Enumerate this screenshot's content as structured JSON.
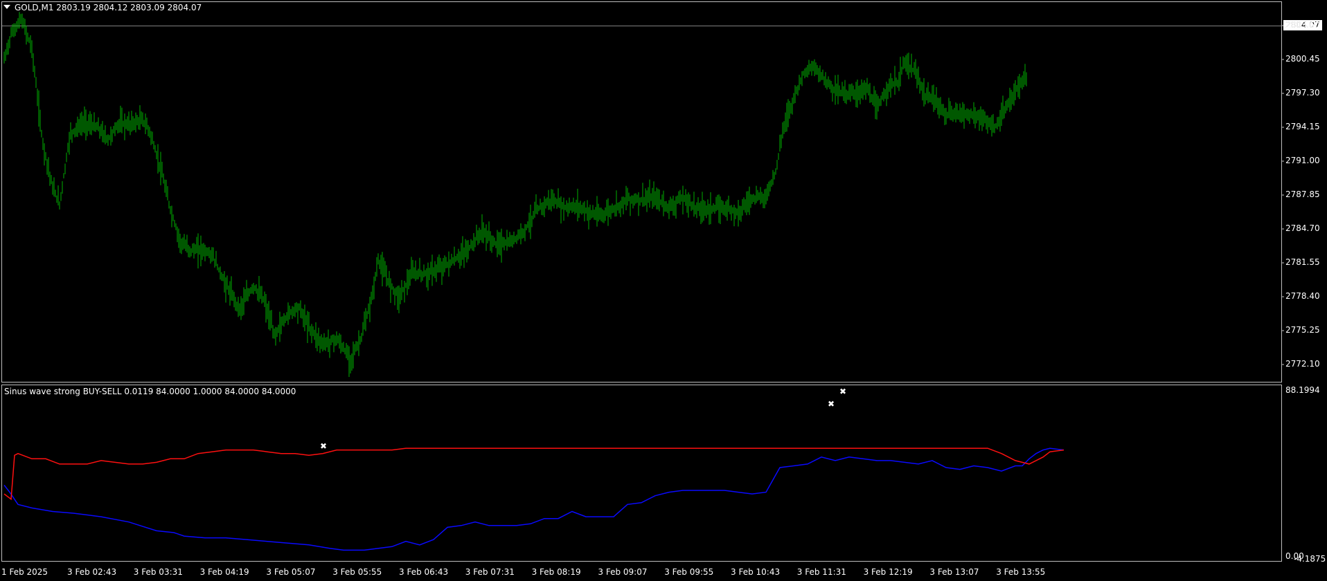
{
  "main_chart": {
    "title": "GOLD,M1  2803.19 2804.12 2803.09 2804.07",
    "current_price": "2804.07",
    "price_axis": [
      "2803.60",
      "2800.45",
      "2797.30",
      "2794.15",
      "2791.00",
      "2787.85",
      "2784.70",
      "2781.55",
      "2778.40",
      "2775.25",
      "2772.10"
    ],
    "time_axis": [
      "1 Feb 2025",
      "3 Feb 02:43",
      "3 Feb 03:31",
      "3 Feb 04:19",
      "3 Feb 05:07",
      "3 Feb 05:55",
      "3 Feb 06:43",
      "3 Feb 07:31",
      "3 Feb 08:19",
      "3 Feb 09:07",
      "3 Feb 09:55",
      "3 Feb 10:43",
      "3 Feb 11:31",
      "3 Feb 12:19",
      "3 Feb 13:07",
      "3 Feb 13:55"
    ],
    "bar_color": "#00b000",
    "price_trace": [
      [
        0,
        2800.4
      ],
      [
        10,
        2802.8
      ],
      [
        25,
        2804.2
      ],
      [
        40,
        2801.5
      ],
      [
        55,
        2793.0
      ],
      [
        70,
        2788.5
      ],
      [
        80,
        2787.0
      ],
      [
        95,
        2793.5
      ],
      [
        115,
        2794.6
      ],
      [
        135,
        2794.1
      ],
      [
        150,
        2793.0
      ],
      [
        165,
        2794.5
      ],
      [
        180,
        2794.4
      ],
      [
        200,
        2794.8
      ],
      [
        210,
        2793.8
      ],
      [
        225,
        2790.5
      ],
      [
        240,
        2786.5
      ],
      [
        255,
        2783.4
      ],
      [
        270,
        2782.7
      ],
      [
        285,
        2782.8
      ],
      [
        300,
        2782.3
      ],
      [
        320,
        2779.5
      ],
      [
        340,
        2777.3
      ],
      [
        360,
        2779.4
      ],
      [
        375,
        2778.1
      ],
      [
        390,
        2774.8
      ],
      [
        410,
        2776.8
      ],
      [
        425,
        2777.5
      ],
      [
        440,
        2775.6
      ],
      [
        460,
        2774.0
      ],
      [
        480,
        2774.5
      ],
      [
        500,
        2772.6
      ],
      [
        515,
        2774.5
      ],
      [
        530,
        2778.0
      ],
      [
        540,
        2781.8
      ],
      [
        555,
        2779.8
      ],
      [
        570,
        2778.4
      ],
      [
        590,
        2780.6
      ],
      [
        610,
        2780.5
      ],
      [
        630,
        2781.1
      ],
      [
        650,
        2781.8
      ],
      [
        670,
        2782.8
      ],
      [
        690,
        2784.5
      ],
      [
        710,
        2783.3
      ],
      [
        730,
        2783.4
      ],
      [
        750,
        2784.5
      ],
      [
        770,
        2786.5
      ],
      [
        790,
        2787.4
      ],
      [
        810,
        2786.7
      ],
      [
        830,
        2786.8
      ],
      [
        845,
        2786.2
      ],
      [
        860,
        2785.9
      ],
      [
        880,
        2786.6
      ],
      [
        900,
        2787.5
      ],
      [
        920,
        2787.4
      ],
      [
        940,
        2787.6
      ],
      [
        960,
        2786.7
      ],
      [
        980,
        2787.6
      ],
      [
        1000,
        2786.6
      ],
      [
        1020,
        2786.6
      ],
      [
        1040,
        2786.7
      ],
      [
        1060,
        2786.3
      ],
      [
        1080,
        2787.6
      ],
      [
        1100,
        2787.7
      ],
      [
        1115,
        2790.3
      ],
      [
        1125,
        2794.2
      ],
      [
        1140,
        2796.9
      ],
      [
        1155,
        2799.3
      ],
      [
        1170,
        2799.7
      ],
      [
        1185,
        2798.6
      ],
      [
        1200,
        2797.6
      ],
      [
        1215,
        2797.3
      ],
      [
        1230,
        2797.3
      ],
      [
        1245,
        2797.8
      ],
      [
        1260,
        2795.8
      ],
      [
        1275,
        2797.9
      ],
      [
        1290,
        2798.3
      ],
      [
        1300,
        2800.2
      ],
      [
        1315,
        2799.3
      ],
      [
        1330,
        2797.0
      ],
      [
        1345,
        2796.7
      ],
      [
        1360,
        2795.3
      ],
      [
        1380,
        2795.5
      ],
      [
        1400,
        2795.3
      ],
      [
        1415,
        2794.8
      ],
      [
        1430,
        2794.1
      ],
      [
        1445,
        2795.6
      ],
      [
        1460,
        2797.6
      ],
      [
        1475,
        2798.6
      ],
      [
        1490,
        2799.5
      ],
      [
        1505,
        2802.0
      ],
      [
        1520,
        2803.6
      ],
      [
        1530,
        2804.07
      ]
    ]
  },
  "indicator": {
    "title": "Sinus wave strong BUY-SELL 0.0119 84.0000 1.0000 84.0000 84.0000",
    "axis_top": "88.1994",
    "axis_bottom": "0.00",
    "axis_bottom_overlap": "-4.1875",
    "series": [
      {
        "name": "blue",
        "color": "#0a0aff",
        "points": [
          [
            0,
            40
          ],
          [
            8,
            36
          ],
          [
            20,
            29
          ],
          [
            40,
            27
          ],
          [
            70,
            25
          ],
          [
            100,
            24
          ],
          [
            140,
            22
          ],
          [
            180,
            19
          ],
          [
            220,
            14
          ],
          [
            245,
            13
          ],
          [
            260,
            11
          ],
          [
            290,
            10
          ],
          [
            320,
            10
          ],
          [
            350,
            9
          ],
          [
            380,
            8
          ],
          [
            410,
            7
          ],
          [
            440,
            6
          ],
          [
            470,
            4
          ],
          [
            490,
            3
          ],
          [
            520,
            3
          ],
          [
            560,
            5
          ],
          [
            580,
            8
          ],
          [
            600,
            6
          ],
          [
            620,
            9
          ],
          [
            640,
            16
          ],
          [
            660,
            17
          ],
          [
            680,
            19
          ],
          [
            700,
            17
          ],
          [
            720,
            17
          ],
          [
            740,
            17
          ],
          [
            760,
            18
          ],
          [
            780,
            21
          ],
          [
            800,
            21
          ],
          [
            820,
            25
          ],
          [
            840,
            22
          ],
          [
            860,
            22
          ],
          [
            880,
            22
          ],
          [
            900,
            29
          ],
          [
            920,
            30
          ],
          [
            940,
            34
          ],
          [
            960,
            36
          ],
          [
            980,
            37
          ],
          [
            1000,
            37
          ],
          [
            1020,
            37
          ],
          [
            1040,
            37
          ],
          [
            1060,
            36
          ],
          [
            1080,
            35
          ],
          [
            1100,
            36
          ],
          [
            1120,
            50
          ],
          [
            1140,
            51
          ],
          [
            1160,
            52
          ],
          [
            1180,
            56
          ],
          [
            1200,
            54
          ],
          [
            1220,
            56
          ],
          [
            1240,
            55
          ],
          [
            1260,
            54
          ],
          [
            1280,
            54
          ],
          [
            1300,
            53
          ],
          [
            1320,
            52
          ],
          [
            1340,
            54
          ],
          [
            1360,
            50
          ],
          [
            1380,
            49
          ],
          [
            1400,
            51
          ],
          [
            1420,
            50
          ],
          [
            1440,
            48
          ],
          [
            1460,
            51
          ],
          [
            1470,
            51
          ],
          [
            1480,
            55
          ],
          [
            1490,
            58
          ],
          [
            1500,
            60
          ],
          [
            1510,
            61
          ],
          [
            1530,
            60
          ]
        ]
      },
      {
        "name": "red",
        "color": "#ff1010",
        "points": [
          [
            0,
            35
          ],
          [
            10,
            32
          ],
          [
            15,
            57
          ],
          [
            20,
            58
          ],
          [
            40,
            55
          ],
          [
            60,
            55
          ],
          [
            80,
            52
          ],
          [
            100,
            52
          ],
          [
            120,
            52
          ],
          [
            140,
            54
          ],
          [
            160,
            53
          ],
          [
            180,
            52
          ],
          [
            200,
            52
          ],
          [
            220,
            53
          ],
          [
            240,
            55
          ],
          [
            260,
            55
          ],
          [
            280,
            58
          ],
          [
            300,
            59
          ],
          [
            320,
            60
          ],
          [
            340,
            60
          ],
          [
            360,
            60
          ],
          [
            380,
            59
          ],
          [
            400,
            58
          ],
          [
            420,
            58
          ],
          [
            440,
            57
          ],
          [
            460,
            58
          ],
          [
            480,
            60
          ],
          [
            500,
            60
          ],
          [
            520,
            60
          ],
          [
            540,
            60
          ],
          [
            560,
            60
          ],
          [
            580,
            61
          ],
          [
            600,
            61
          ],
          [
            620,
            61
          ],
          [
            640,
            61
          ],
          [
            660,
            61
          ],
          [
            680,
            61
          ],
          [
            700,
            61
          ],
          [
            720,
            61
          ],
          [
            740,
            61
          ],
          [
            760,
            61
          ],
          [
            780,
            61
          ],
          [
            800,
            61
          ],
          [
            820,
            61
          ],
          [
            840,
            61
          ],
          [
            860,
            61
          ],
          [
            880,
            61
          ],
          [
            900,
            61
          ],
          [
            920,
            61
          ],
          [
            940,
            61
          ],
          [
            960,
            61
          ],
          [
            980,
            61
          ],
          [
            1000,
            61
          ],
          [
            1020,
            61
          ],
          [
            1040,
            61
          ],
          [
            1060,
            61
          ],
          [
            1080,
            61
          ],
          [
            1100,
            61
          ],
          [
            1120,
            61
          ],
          [
            1140,
            61
          ],
          [
            1160,
            61
          ],
          [
            1180,
            61
          ],
          [
            1200,
            61
          ],
          [
            1220,
            61
          ],
          [
            1240,
            61
          ],
          [
            1260,
            61
          ],
          [
            1280,
            61
          ],
          [
            1300,
            61
          ],
          [
            1320,
            61
          ],
          [
            1340,
            61
          ],
          [
            1360,
            61
          ],
          [
            1380,
            61
          ],
          [
            1400,
            61
          ],
          [
            1420,
            61
          ],
          [
            1440,
            58
          ],
          [
            1460,
            54
          ],
          [
            1480,
            52
          ],
          [
            1500,
            56
          ],
          [
            1510,
            59
          ],
          [
            1530,
            60
          ]
        ]
      }
    ]
  }
}
